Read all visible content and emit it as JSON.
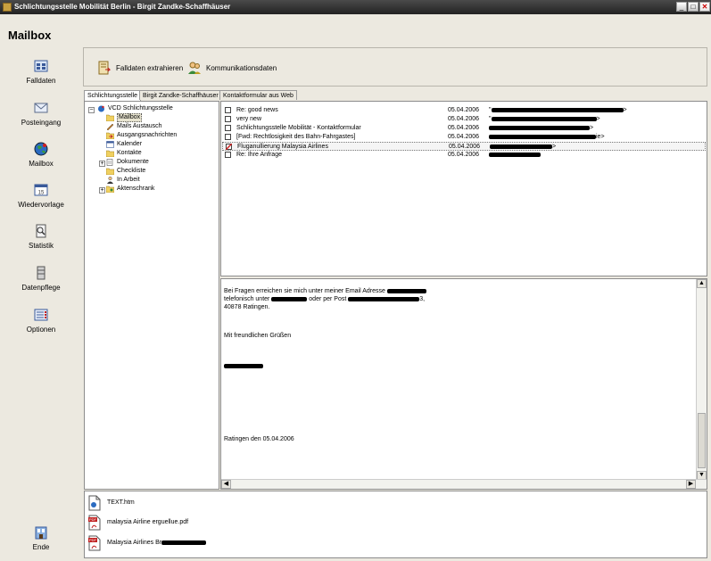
{
  "window": {
    "title": "Schlichtungsstelle Mobilität Berlin - Birgit Zandke-Schaffhäuser",
    "minimize": "_",
    "maximize": "□",
    "close": "✕"
  },
  "page": {
    "heading": "Mailbox"
  },
  "sidebar": {
    "items": [
      {
        "label": "Falldaten",
        "icon": "falldaten-icon"
      },
      {
        "label": "Posteingang",
        "icon": "envelope-icon"
      },
      {
        "label": "Mailbox",
        "icon": "globe-icon"
      },
      {
        "label": "Wiedervorlage",
        "icon": "calendar-icon"
      },
      {
        "label": "Statistik",
        "icon": "statistics-icon"
      },
      {
        "label": "Datenpflege",
        "icon": "database-icon"
      },
      {
        "label": "Optionen",
        "icon": "options-icon"
      },
      {
        "label": "Ende",
        "icon": "exit-icon"
      }
    ]
  },
  "toolbar": {
    "extract_label": "Falldaten extrahieren",
    "comm_label": "Kommunikationsdaten"
  },
  "tabs": [
    {
      "label": "Schlichtungsstelle",
      "active": true
    },
    {
      "label": "Birgit Zandke-Schaffhäuser",
      "active": false
    },
    {
      "label": "Kontaktformular aus Web",
      "active": false
    }
  ],
  "tree": {
    "root": "VCD Schlichtungsstelle",
    "children": [
      {
        "label": "Mailbox",
        "selected": true
      },
      {
        "label": "Mails Austausch"
      },
      {
        "label": "Ausgangsnachrichten"
      },
      {
        "label": "Kalender"
      },
      {
        "label": "Kontakte"
      },
      {
        "label": "Dokumente",
        "expandable": true
      },
      {
        "label": "Checkliste"
      },
      {
        "label": "In Arbeit"
      },
      {
        "label": "Aktenschrank",
        "expandable": true
      }
    ]
  },
  "mails": [
    {
      "subject": "Re: good news",
      "date": "05.04.2006",
      "from_prefix": "\"",
      "from_suffix": ">"
    },
    {
      "subject": "very new",
      "date": "05.04.2006",
      "from_prefix": "\"",
      "from_suffix": ">"
    },
    {
      "subject": "Schlichtungsstelle Mobilität - Kontaktformular",
      "date": "05.04.2006",
      "from_prefix": "",
      "from_suffix": ">"
    },
    {
      "subject": "[Fwd: Rechtlosigkeit des Bahn-Fahrgastes]",
      "date": "05.04.2006",
      "from_prefix": "",
      "from_suffix": "ie>"
    },
    {
      "subject": "Fluganullierung Malaysia Airlines",
      "date": "05.04.2006",
      "from_prefix": "",
      "from_suffix": ">",
      "selected": true,
      "flagged": true
    },
    {
      "subject": "Re: Ihre Anfrage",
      "date": "05.04.2006",
      "from_prefix": "",
      "from_suffix": ""
    }
  ],
  "preview": {
    "line1": "Bei Fragen erreichen sie mich unter meiner Email Adresse",
    "line2a": "telefonisch unter",
    "line2b": "oder per Post",
    "line2c": "3,",
    "line3": "40878 Ratingen.",
    "greeting": "Mit freundlichen Grüßen",
    "closing": "Ratingen den 05.04.2006"
  },
  "attachments": [
    {
      "name": "TEXT.htm",
      "icon": "html-file-icon"
    },
    {
      "name": "malaysia Airline erguellue.pdf",
      "icon": "pdf-file-icon"
    },
    {
      "name": "Malaysia Airlines Br",
      "icon": "pdf-file-icon"
    }
  ],
  "scroll": {
    "up": "▲",
    "down": "▼",
    "left": "◀",
    "right": "▶"
  }
}
